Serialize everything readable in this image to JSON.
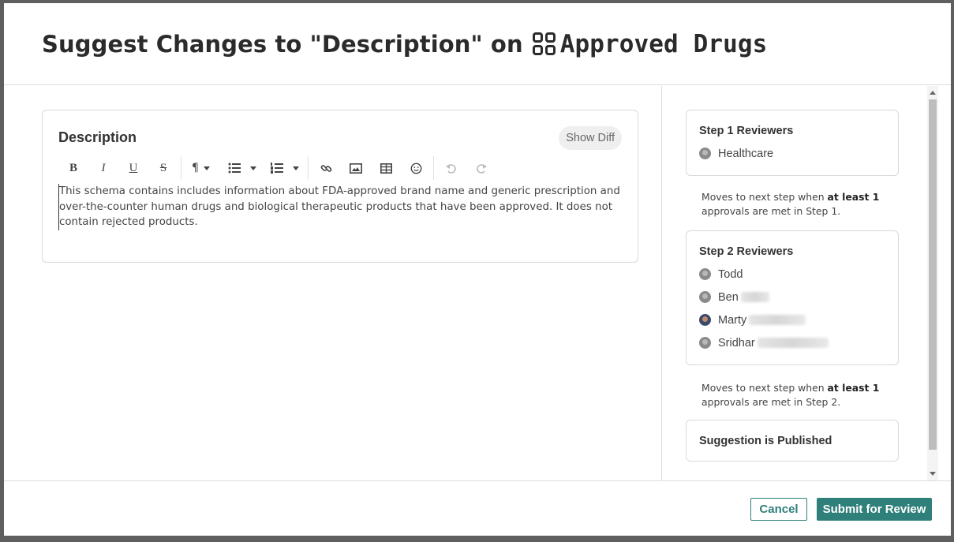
{
  "header": {
    "title_prefix": "Suggest Changes to \"Description\" on",
    "asset_name": "Approved Drugs",
    "asset_icon": "grid-icon"
  },
  "editor": {
    "label": "Description",
    "show_diff_label": "Show Diff",
    "toolbar": [
      {
        "name": "bold-icon",
        "glyph": "B"
      },
      {
        "name": "italic-icon",
        "glyph": "I"
      },
      {
        "name": "underline-icon",
        "glyph": "U"
      },
      {
        "name": "strikethrough-icon",
        "glyph": "S"
      },
      {
        "name": "paragraph-icon",
        "glyph": "¶"
      },
      {
        "name": "bullet-list-icon",
        "glyph": "☰"
      },
      {
        "name": "numbered-list-icon",
        "glyph": "☰"
      },
      {
        "name": "link-icon",
        "glyph": "🔗"
      },
      {
        "name": "image-icon",
        "glyph": "▣"
      },
      {
        "name": "table-icon",
        "glyph": "⊞"
      },
      {
        "name": "emoji-icon",
        "glyph": "☺"
      },
      {
        "name": "undo-icon",
        "glyph": "↶"
      },
      {
        "name": "redo-icon",
        "glyph": "↷"
      }
    ],
    "content": "This schema contains includes information about FDA-approved brand name and generic prescription and over-the-counter human drugs and biological therapeutic products that have been approved.  It does not contain rejected products."
  },
  "workflow": {
    "step1": {
      "title": "Step 1 Reviewers",
      "reviewers": [
        {
          "name": "Healthcare"
        }
      ]
    },
    "step1_note_prefix": "Moves to next step when ",
    "step1_note_bold": "at least 1",
    "step1_note_suffix": " approvals are met in Step 1.",
    "step2": {
      "title": "Step 2 Reviewers",
      "reviewers": [
        {
          "name": "Todd"
        },
        {
          "name": "Ben"
        },
        {
          "name": "Marty"
        },
        {
          "name": "Sridhar"
        }
      ]
    },
    "step2_note_prefix": "Moves to next step when ",
    "step2_note_bold": "at least 1",
    "step2_note_suffix": " approvals are met in Step 2.",
    "final": "Suggestion is Published"
  },
  "footer": {
    "cancel_label": "Cancel",
    "submit_label": "Submit for Review"
  },
  "colors": {
    "accent": "#2f7f7a",
    "overlay": "#5f5f5f"
  }
}
